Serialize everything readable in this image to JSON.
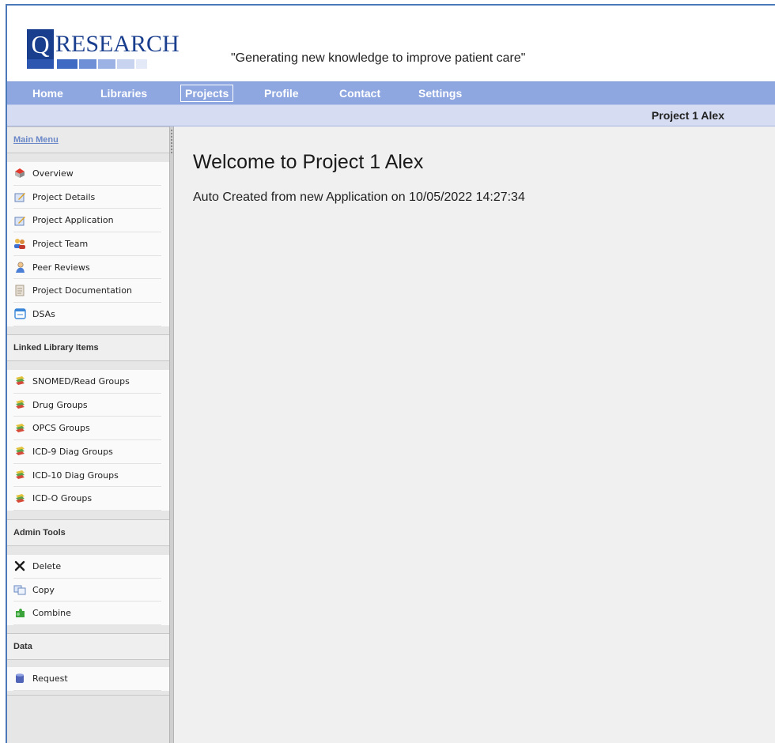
{
  "brand": {
    "logo_letter": "Q",
    "logo_text": "RESEARCH",
    "tagline": "\"Generating new knowledge to improve patient care\"",
    "colors": {
      "logo_blue": "#1a3e8e",
      "nav": "#8fa7e0",
      "subnav": "#d6ddf2"
    }
  },
  "nav": {
    "items": [
      {
        "label": "Home"
      },
      {
        "label": "Libraries"
      },
      {
        "label": "Projects",
        "active": true
      },
      {
        "label": "Profile"
      },
      {
        "label": "Contact"
      },
      {
        "label": "Settings"
      }
    ]
  },
  "subnav": {
    "project_name": "Project 1 Alex"
  },
  "sidebar": {
    "main_menu": {
      "title": "Main Menu",
      "items": [
        {
          "label": "Overview",
          "icon": "overview-icon"
        },
        {
          "label": "Project Details",
          "icon": "edit-pencil-icon"
        },
        {
          "label": "Project Application",
          "icon": "edit-pencil-icon"
        },
        {
          "label": "Project Team",
          "icon": "team-icon"
        },
        {
          "label": "Peer Reviews",
          "icon": "reviewer-icon"
        },
        {
          "label": "Project Documentation",
          "icon": "document-icon"
        },
        {
          "label": "DSAs",
          "icon": "window-icon"
        }
      ]
    },
    "linked": {
      "title": "Linked Library Items",
      "items": [
        {
          "label": "SNOMED/Read Groups",
          "icon": "stack-icon"
        },
        {
          "label": "Drug Groups",
          "icon": "stack-icon"
        },
        {
          "label": "OPCS Groups",
          "icon": "stack-icon"
        },
        {
          "label": "ICD-9 Diag Groups",
          "icon": "stack-icon"
        },
        {
          "label": "ICD-10 Diag Groups",
          "icon": "stack-icon"
        },
        {
          "label": "ICD-O Groups",
          "icon": "stack-icon"
        }
      ]
    },
    "admin": {
      "title": "Admin Tools",
      "items": [
        {
          "label": "Delete",
          "icon": "delete-x-icon"
        },
        {
          "label": "Copy",
          "icon": "copy-icon"
        },
        {
          "label": "Combine",
          "icon": "puzzle-icon"
        }
      ]
    },
    "data": {
      "title": "Data",
      "items": [
        {
          "label": "Request",
          "icon": "database-icon"
        }
      ]
    }
  },
  "main": {
    "title": "Welcome to Project 1 Alex",
    "subtitle": "Auto Created from new Application on 10/05/2022 14:27:34"
  }
}
